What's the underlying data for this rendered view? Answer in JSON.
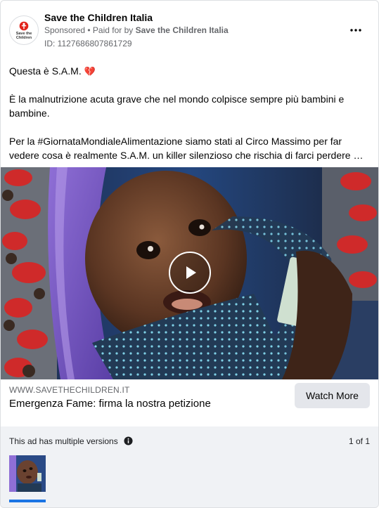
{
  "advertiser": {
    "name": "Save the Children Italia",
    "logo_text": "Save the Children",
    "sponsored_label": "Sponsored",
    "paid_for_prefix": " • Paid for by ",
    "paid_for_by": "Save the Children Italia",
    "ad_id": "ID: 1127686807861729"
  },
  "body": {
    "line1": "Questa è S.A.M.",
    "line1_emoji": "💔",
    "paragraph2": "È la malnutrizione acuta grave che nel mondo colpisce sempre più bambini e bambine.",
    "paragraph3": "Per la #GiornataMondialeAlimentazione siamo stati al Circo Massimo per far vedere cosa è realmente S.A.M. un killer silenzioso che rischia di farci perdere …"
  },
  "cta": {
    "domain": "WWW.SAVETHECHILDREN.IT",
    "headline": "Emergenza Fame: firma la nostra petizione",
    "button_label": "Watch More"
  },
  "versions": {
    "label": "This ad has multiple versions",
    "counter": "1 of 1"
  },
  "colors": {
    "brand_red": "#e2231a",
    "accent_blue": "#1b74e4",
    "muted_text": "#65676b"
  }
}
